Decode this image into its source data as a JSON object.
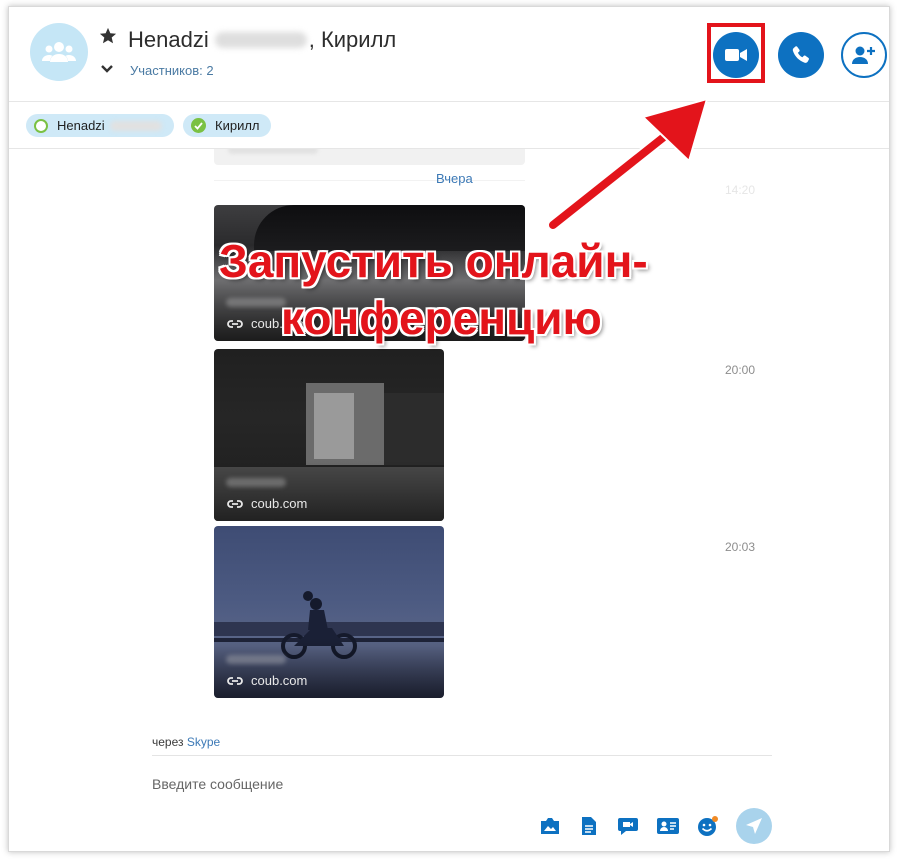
{
  "header": {
    "title_first": "Henadzi",
    "title_rest": ", Кирилл",
    "subtitle": "Участников: 2"
  },
  "participants": [
    {
      "name": "Henadzi"
    },
    {
      "name": "Кирилл"
    }
  ],
  "messages": {
    "day_label": "Вчера",
    "items": [
      {
        "link": "coub.com",
        "time": ""
      },
      {
        "link": "coub.com",
        "time": "20:00"
      },
      {
        "link": "coub.com",
        "time": "20:03"
      }
    ]
  },
  "annotation": {
    "line1": "Запустить онлайн-",
    "line2": "конференцию",
    "color": "#e3141b"
  },
  "footer": {
    "via_prefix": "через",
    "via_link": "Skype",
    "compose_placeholder": "Введите сообщение"
  },
  "icons": [
    "group-avatar-icon",
    "star-icon",
    "chevron-down-icon",
    "video-call-icon",
    "phone-icon",
    "add-participant-icon",
    "link-icon",
    "image-share-icon",
    "file-icon",
    "chat-icon",
    "contact-card-icon",
    "emoji-icon",
    "send-icon"
  ],
  "colors": {
    "accent": "#0d71c1",
    "link": "#3c79b6",
    "online": "#7ac143"
  }
}
